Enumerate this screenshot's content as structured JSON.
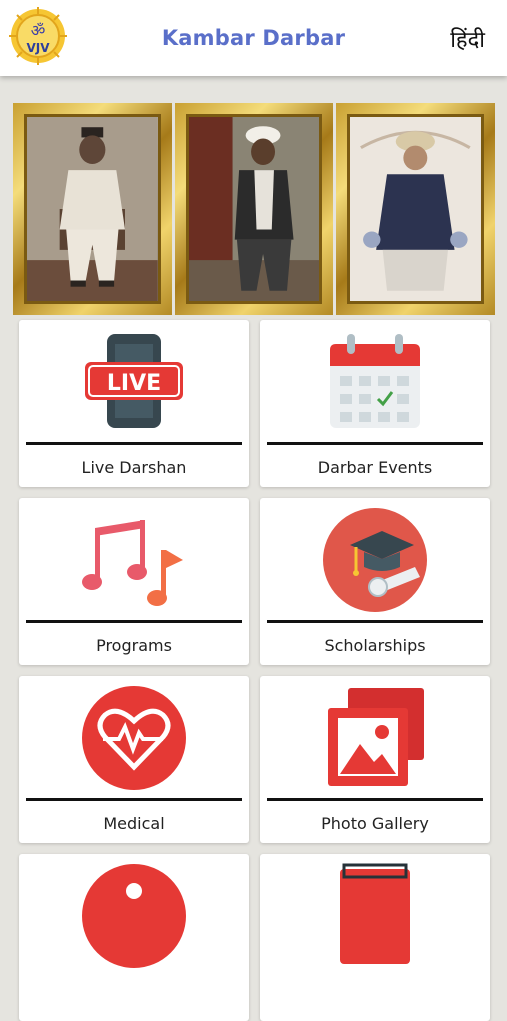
{
  "header": {
    "title": "Kambar Darbar",
    "language_toggle": "हिंदी",
    "logo_text": "VJV"
  },
  "portraits": [
    {
      "name": "portrait-1"
    },
    {
      "name": "portrait-2"
    },
    {
      "name": "portrait-3"
    }
  ],
  "menu": {
    "live_darshan": "Live Darshan",
    "live_badge": "LIVE",
    "darbar_events": "Darbar Events",
    "programs": "Programs",
    "scholarships": "Scholarships",
    "medical": "Medical",
    "photo_gallery": "Photo Gallery"
  },
  "colors": {
    "accent_title": "#5a6fc9",
    "icon_red": "#e53935",
    "icon_orange": "#f26f45",
    "gold_frame": "#d4ad3c"
  }
}
